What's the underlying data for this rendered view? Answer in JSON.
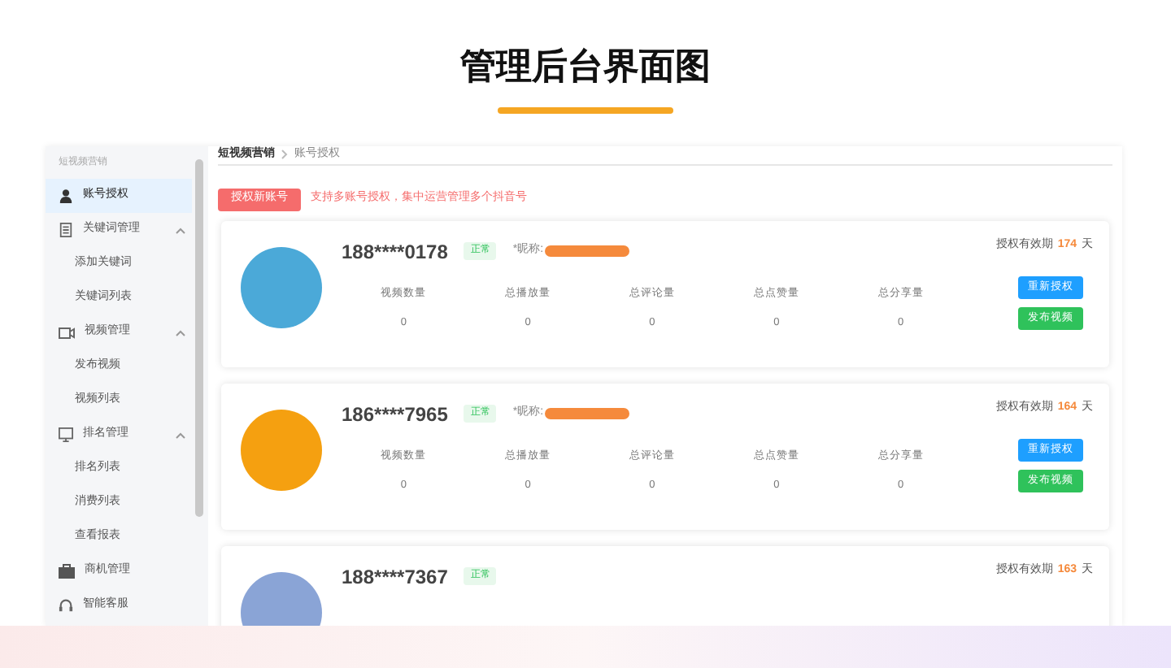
{
  "title": "管理后台界面图",
  "sidebar": {
    "section_label": "短视频营销",
    "items": [
      {
        "label": "账号授权",
        "kind": "user",
        "selected": true
      },
      {
        "label": "关键词管理",
        "kind": "doc",
        "selected": false,
        "expanded": true,
        "children": [
          {
            "label": "添加关键词",
            "selected": false
          },
          {
            "label": "关键词列表",
            "selected": false
          }
        ]
      },
      {
        "label": "视频管理",
        "kind": "video",
        "selected": false,
        "expanded": true,
        "children": [
          {
            "label": "发布视频",
            "selected": false
          },
          {
            "label": "视频列表",
            "selected": false
          }
        ]
      },
      {
        "label": "排名管理",
        "kind": "rank",
        "selected": false,
        "expanded": true,
        "children": [
          {
            "label": "排名列表",
            "selected": false
          },
          {
            "label": "消费列表",
            "selected": false
          },
          {
            "label": "查看报表",
            "selected": false
          }
        ]
      },
      {
        "label": "商机管理",
        "kind": "briefcase",
        "selected": false
      },
      {
        "label": "智能客服",
        "kind": "headset",
        "selected": false
      }
    ]
  },
  "breadcrumb": [
    "短视频营销",
    "账号授权"
  ],
  "add_button": "授权新账号",
  "hint": "支持多账号授权，集中运营管理多个抖音号",
  "accounts": [
    {
      "phone": "188****0178",
      "status": "正常",
      "nickname_label": "*昵称:",
      "valid_label": "授权有效期",
      "days": "174",
      "unit": "天",
      "stats": [
        {
          "label": "视频数量",
          "value": "0"
        },
        {
          "label": "总播放量",
          "value": "0"
        },
        {
          "label": "总评论量",
          "value": "0"
        },
        {
          "label": "总点赞量",
          "value": "0"
        },
        {
          "label": "总分享量",
          "value": "0"
        }
      ],
      "buttons": [
        {
          "label": "重新授权",
          "kind": "primary"
        },
        {
          "label": "发布视频",
          "kind": "success"
        }
      ]
    },
    {
      "phone": "186****7965",
      "status": "正常",
      "nickname_label": "*昵称:",
      "valid_label": "授权有效期",
      "days": "164",
      "unit": "天",
      "stats": [
        {
          "label": "视频数量",
          "value": "0"
        },
        {
          "label": "总播放量",
          "value": "0"
        },
        {
          "label": "总评论量",
          "value": "0"
        },
        {
          "label": "总点赞量",
          "value": "0"
        },
        {
          "label": "总分享量",
          "value": "0"
        }
      ],
      "buttons": [
        {
          "label": "重新授权",
          "kind": "primary"
        },
        {
          "label": "发布视频",
          "kind": "success"
        }
      ]
    },
    {
      "phone": "188****7367",
      "status": "正常",
      "valid_label": "授权有效期",
      "days": "163",
      "unit": "天"
    }
  ]
}
